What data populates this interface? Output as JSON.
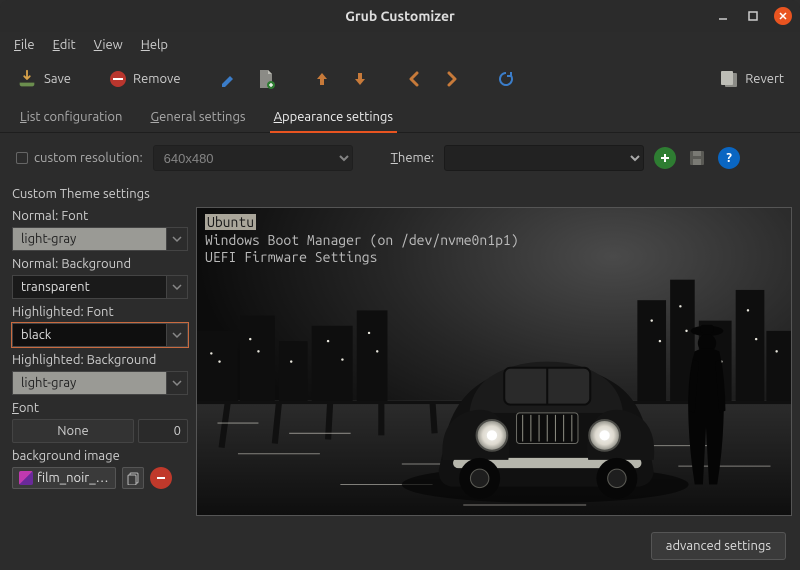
{
  "window": {
    "title": "Grub Customizer"
  },
  "menubar": {
    "file": "File",
    "edit": "Edit",
    "view": "View",
    "help": "Help"
  },
  "toolbar": {
    "save": "Save",
    "remove": "Remove",
    "revert": "Revert",
    "icons": {
      "save": "download-icon",
      "remove": "minus-circle-icon",
      "edit": "pencil-icon",
      "new": "page-plus-icon",
      "up": "arrow-up-icon",
      "down": "arrow-down-icon",
      "left": "chevron-left-icon",
      "right": "chevron-right-icon",
      "refresh": "refresh-icon",
      "revert": "revert-icon"
    }
  },
  "tabs": {
    "list": "List configuration",
    "general": "General settings",
    "appearance": "Appearance settings",
    "active": "appearance"
  },
  "topform": {
    "custom_resolution_label": "custom resolution:",
    "resolution_value": "640x480",
    "theme_label": "Theme:",
    "theme_value": ""
  },
  "custom_theme": {
    "section": "Custom Theme settings",
    "normal_font_label": "Normal: Font",
    "normal_font_value": "light-gray",
    "normal_bg_label": "Normal: Background",
    "normal_bg_value": "transparent",
    "hl_font_label": "Highlighted: Font",
    "hl_font_value": "black",
    "hl_bg_label": "Highlighted: Background",
    "hl_bg_value": "light-gray",
    "font_label": "Font",
    "font_value": "None",
    "font_size": "0",
    "bg_label": "background image",
    "bg_file": "film_noir_…"
  },
  "preview": {
    "entries": [
      {
        "label": "Ubuntu",
        "selected": true
      },
      {
        "label": "Windows Boot Manager (on /dev/nvme0n1p1)",
        "selected": false
      },
      {
        "label": "UEFI Firmware Settings",
        "selected": false
      }
    ]
  },
  "footer": {
    "advanced": "advanced settings"
  }
}
